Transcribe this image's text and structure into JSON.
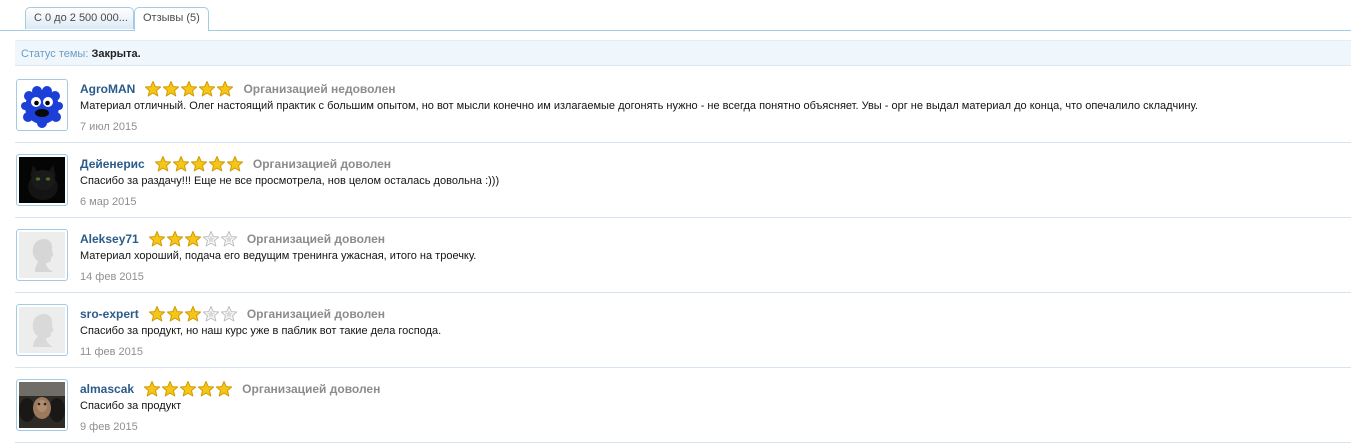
{
  "tabs": [
    {
      "label": "С 0 до 2 500 000...",
      "active": false
    },
    {
      "label": "Отзывы (5)",
      "active": true
    }
  ],
  "status": {
    "label": "Статус темы:",
    "value": "Закрыта."
  },
  "colors": {
    "accent_border": "#a5cae4",
    "username": "#2b5b8a",
    "star_filled": "#f5c518",
    "star_empty": "#d9d9d9",
    "verdict": "#8c8c8c"
  },
  "reviews": [
    {
      "username": "AgroMAN",
      "rating": 5,
      "max_rating": 5,
      "verdict": "Организацией недоволен",
      "text": "Материал отличный. Олег настоящий практик с большим опытом, но вот мысли конечно им излагаемые догонять нужно - не всегда понятно объясняет. Увы - орг не выдал материал до конца, что опечалило складчину.",
      "date": "7 июл 2015",
      "avatar": "blue-monster-avatar"
    },
    {
      "username": "Дейенерис",
      "rating": 5,
      "max_rating": 5,
      "verdict": "Организацией доволен",
      "text": "Спасибо за раздачу!!! Еще не все просмотрела, нов целом осталась довольна :)))",
      "date": "6 мар 2015",
      "avatar": "black-cat-avatar"
    },
    {
      "username": "Aleksey71",
      "rating": 3,
      "max_rating": 5,
      "verdict": "Организацией доволен",
      "text": "Материал хороший, подача его ведущим тренинга ужасная, итого на троечку.",
      "date": "14 фев 2015",
      "avatar": "default-silhouette-avatar"
    },
    {
      "username": "sro-expert",
      "rating": 3,
      "max_rating": 5,
      "verdict": "Организацией доволен",
      "text": "Спасибо за продукт, но наш курс уже в паблик вот такие дела господа.",
      "date": "11 фев 2015",
      "avatar": "default-silhouette-avatar"
    },
    {
      "username": "almascak",
      "rating": 5,
      "max_rating": 5,
      "verdict": "Организацией доволен",
      "text": "Спасибо за продукт",
      "date": "9 фев 2015",
      "avatar": "photo-avatar"
    }
  ]
}
